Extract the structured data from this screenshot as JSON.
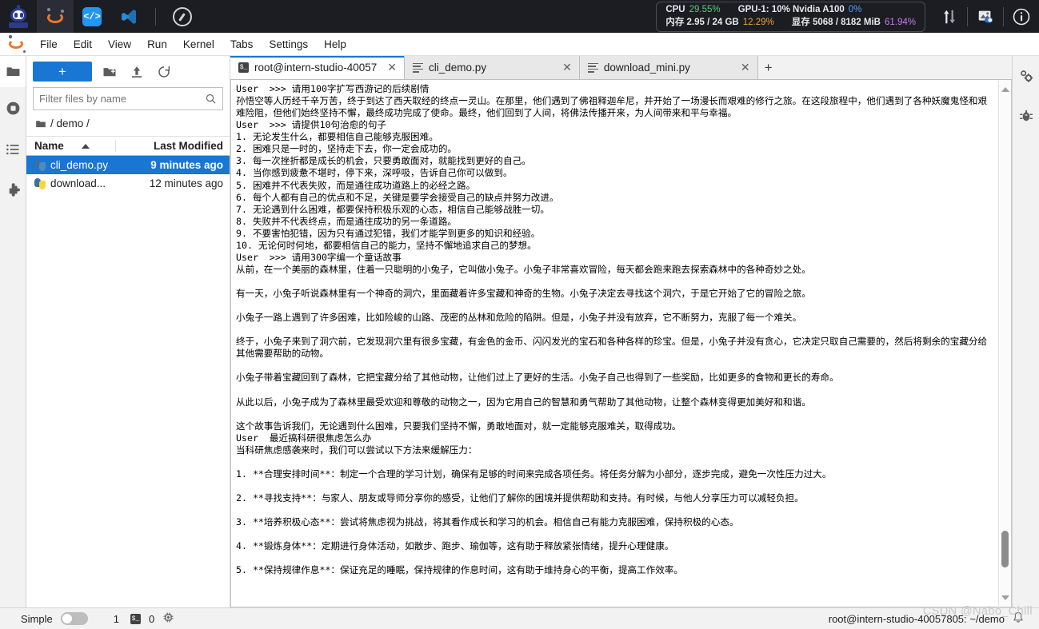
{
  "topbar": {
    "icons": [
      {
        "name": "intern-studio-logo",
        "label": ""
      },
      {
        "name": "jupyter-icon",
        "label": ""
      },
      {
        "name": "code-server-icon",
        "label": "</>"
      },
      {
        "name": "vscode-icon",
        "label": ""
      },
      {
        "name": "compass-icon",
        "label": ""
      }
    ],
    "stats": {
      "cpu_label": "CPU",
      "cpu_value": "29.55%",
      "cpu_color": "#5bc77e",
      "gpu_label": "GPU-1: 10% Nvidia A100",
      "gpu_value": "0%",
      "gpu_color": "#4da3ff",
      "mem_label": "内存 2.95 / 24 GB",
      "mem_value": "12.29%",
      "mem_color": "#e8a33d",
      "vram_label": "显存 5068 / 8182 MiB",
      "vram_value": "61.94%",
      "vram_color": "#c77bf0"
    },
    "right_icons": [
      {
        "name": "upload-download-icon"
      },
      {
        "name": "screenshot-icon"
      },
      {
        "name": "info-icon"
      }
    ]
  },
  "menubar": {
    "items": [
      {
        "label": "File"
      },
      {
        "label": "Edit"
      },
      {
        "label": "View"
      },
      {
        "label": "Run"
      },
      {
        "label": "Kernel"
      },
      {
        "label": "Tabs"
      },
      {
        "label": "Settings"
      },
      {
        "label": "Help"
      }
    ]
  },
  "left_rail": {
    "items": [
      {
        "name": "file-browser-icon"
      },
      {
        "name": "running-terminals-icon"
      },
      {
        "name": "table-of-contents-icon"
      },
      {
        "name": "extension-manager-icon"
      }
    ]
  },
  "right_rail": {
    "items": [
      {
        "name": "property-inspector-icon"
      },
      {
        "name": "debugger-icon"
      }
    ]
  },
  "file_browser": {
    "new_button_label": "+",
    "toolbar_icons": [
      {
        "name": "new-folder-icon"
      },
      {
        "name": "upload-icon"
      },
      {
        "name": "refresh-icon"
      }
    ],
    "filter_placeholder": "Filter files by name",
    "filter_value": "",
    "breadcrumb": "/ demo /",
    "columns": {
      "name": "Name",
      "last_modified": "Last Modified"
    },
    "rows": [
      {
        "name": "cli_demo.py",
        "modified": "9 minutes ago",
        "selected": true
      },
      {
        "name": "download...",
        "modified": "12 minutes ago",
        "selected": false
      }
    ]
  },
  "tabs": [
    {
      "label": "root@intern-studio-40057",
      "icon": "terminal-icon",
      "active": true
    },
    {
      "label": "cli_demo.py",
      "icon": "text-file-icon",
      "active": false
    },
    {
      "label": "download_mini.py",
      "icon": "text-file-icon",
      "active": false
    }
  ],
  "new_tab_label": "+",
  "terminal": {
    "lines": [
      "User  >>> 请用100字扩写西游记的后续剧情",
      "孙悟空等人历经千辛万苦，终于到达了西天取经的终点一灵山。在那里，他们遇到了佛祖释迦牟尼，并开始了一场漫长而艰难的修行之旅。在这段旅程中，他们遇到了各种妖魔鬼怪和艰难险阻，但他们始终坚持不懈，最终成功完成了使命。最终，他们回到了人间，将佛法传播开来，为人间带来和平与幸福。",
      "User  >>> 请提供10句治愈的句子",
      "1. 无论发生什么，都要相信自己能够克服困难。",
      "2. 困难只是一时的，坚持走下去，你一定会成功的。",
      "3. 每一次挫折都是成长的机会，只要勇敢面对，就能找到更好的自己。",
      "4. 当你感到疲惫不堪时，停下来，深呼吸，告诉自己你可以做到。",
      "5. 困难并不代表失败，而是通往成功道路上的必经之路。",
      "6. 每个人都有自己的优点和不足，关键是要学会接受自己的缺点并努力改进。",
      "7. 无论遇到什么困难，都要保持积极乐观的心态，相信自己能够战胜一切。",
      "8. 失败并不代表终点，而是通往成功的另一条道路。",
      "9. 不要害怕犯错，因为只有通过犯错，我们才能学到更多的知识和经验。",
      "10. 无论何时何地，都要相信自己的能力，坚持不懈地追求自己的梦想。",
      "User  >>> 请用300字编一个童话故事",
      "从前，在一个美丽的森林里，住着一只聪明的小兔子，它叫做小兔子。小兔子非常喜欢冒险，每天都会跑来跑去探索森林中的各种奇妙之处。",
      "",
      "有一天，小兔子听说森林里有一个神奇的洞穴，里面藏着许多宝藏和神奇的生物。小兔子决定去寻找这个洞穴，于是它开始了它的冒险之旅。",
      "",
      "小兔子一路上遇到了许多困难，比如险峻的山路、茂密的丛林和危险的陷阱。但是，小兔子并没有放弃，它不断努力，克服了每一个难关。",
      "",
      "终于，小兔子来到了洞穴前，它发现洞穴里有很多宝藏，有金色的金币、闪闪发光的宝石和各种各样的珍宝。但是，小兔子并没有贪心，它决定只取自己需要的，然后将剩余的宝藏分给其他需要帮助的动物。",
      "",
      "小兔子带着宝藏回到了森林，它把宝藏分给了其他动物，让他们过上了更好的生活。小兔子自己也得到了一些奖励，比如更多的食物和更长的寿命。",
      "",
      "从此以后，小兔子成为了森林里最受欢迎和尊敬的动物之一，因为它用自己的智慧和勇气帮助了其他动物，让整个森林变得更加美好和和谐。",
      "",
      "这个故事告诉我们，无论遇到什么困难，只要我们坚持不懈，勇敢地面对，就一定能够克服难关，取得成功。",
      "User  最近搞科研很焦虑怎么办",
      "当科研焦虑感袭来时，我们可以尝试以下方法来缓解压力：",
      "",
      "1. **合理安排时间**：制定一个合理的学习计划，确保有足够的时间来完成各项任务。将任务分解为小部分，逐步完成，避免一次性压力过大。",
      "",
      "2. **寻找支持**：与家人、朋友或导师分享你的感受，让他们了解你的困境并提供帮助和支持。有时候，与他人分享压力可以减轻负担。",
      "",
      "3. **培养积极心态**：尝试将焦虑视为挑战，将其看作成长和学习的机会。相信自己有能力克服困难，保持积极的心态。",
      "",
      "4. **锻炼身体**：定期进行身体活动，如散步、跑步、瑜伽等，这有助于释放紧张情绪，提升心理健康。",
      "",
      "5. **保持规律作息**：保证充足的睡眠，保持规律的作息时间，这有助于维持身心的平衡，提高工作效率。"
    ]
  },
  "statusbar": {
    "simple_label": "Simple",
    "simple_on": false,
    "tab_count": "1",
    "terminal_icon_label": "$_",
    "kernel_count": "0",
    "kernel_icon": "kernel-icon",
    "path": "root@intern-studio-40057805: ~/demo",
    "watermark": "CSDN @Nabo_Chill",
    "bell_icon": "notification-bell-icon"
  }
}
